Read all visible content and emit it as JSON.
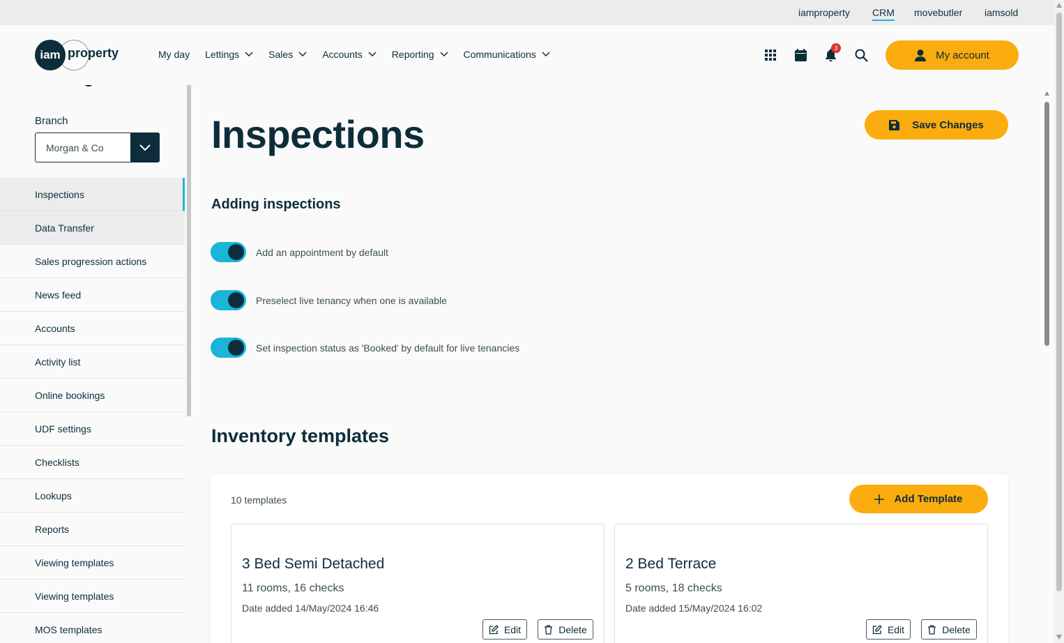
{
  "topbar": {
    "links": [
      "iamproperty",
      "CRM",
      "movebutler",
      "iamsold"
    ],
    "active": "CRM"
  },
  "header": {
    "logo_circle": "iam",
    "logo_word": "property",
    "nav": [
      "My day",
      "Lettings",
      "Sales",
      "Accounts",
      "Reporting",
      "Communications"
    ],
    "notification_count": "3",
    "account_label": "My account",
    "icons": [
      "apps-grid-icon",
      "calendar-icon",
      "bell-icon",
      "search-icon",
      "user-icon"
    ]
  },
  "sidebar": {
    "branch_label": "Branch",
    "branch_value": "Morgan & Co",
    "items": [
      "Inspections",
      "Data Transfer",
      "Sales progression actions",
      "News feed",
      "Accounts",
      "Activity list",
      "Online bookings",
      "UDF settings",
      "Checklists",
      "Lookups",
      "Reports",
      "Viewing templates",
      "Viewing templates",
      "MOS templates"
    ]
  },
  "main": {
    "title": "Inspections",
    "save_label": "Save Changes",
    "section_title": "Adding inspections",
    "toggles": [
      {
        "label": "Add an appointment by default",
        "on": true
      },
      {
        "label": "Preselect live tenancy when one is available",
        "on": true
      },
      {
        "label": "Set inspection status as 'Booked' by default for live tenancies",
        "on": true
      }
    ],
    "inventory_title": "Inventory templates",
    "template_count": "10 templates",
    "add_label": "Add Template",
    "templates": [
      {
        "name": "3 Bed Semi Detached",
        "meta": "11 rooms, 16 checks",
        "date": "Date added 14/May/2024 16:46",
        "edit": "Edit",
        "delete": "Delete"
      },
      {
        "name": "2 Bed Terrace",
        "meta": "5 rooms, 18 checks",
        "date": "Date added 15/May/2024 16:02",
        "edit": "Edit",
        "delete": "Delete"
      }
    ]
  },
  "colors": {
    "primary": "#0d2d3a",
    "accent": "#fbac0f",
    "toggle": "#1ab5d8",
    "badge": "#d8342c"
  }
}
